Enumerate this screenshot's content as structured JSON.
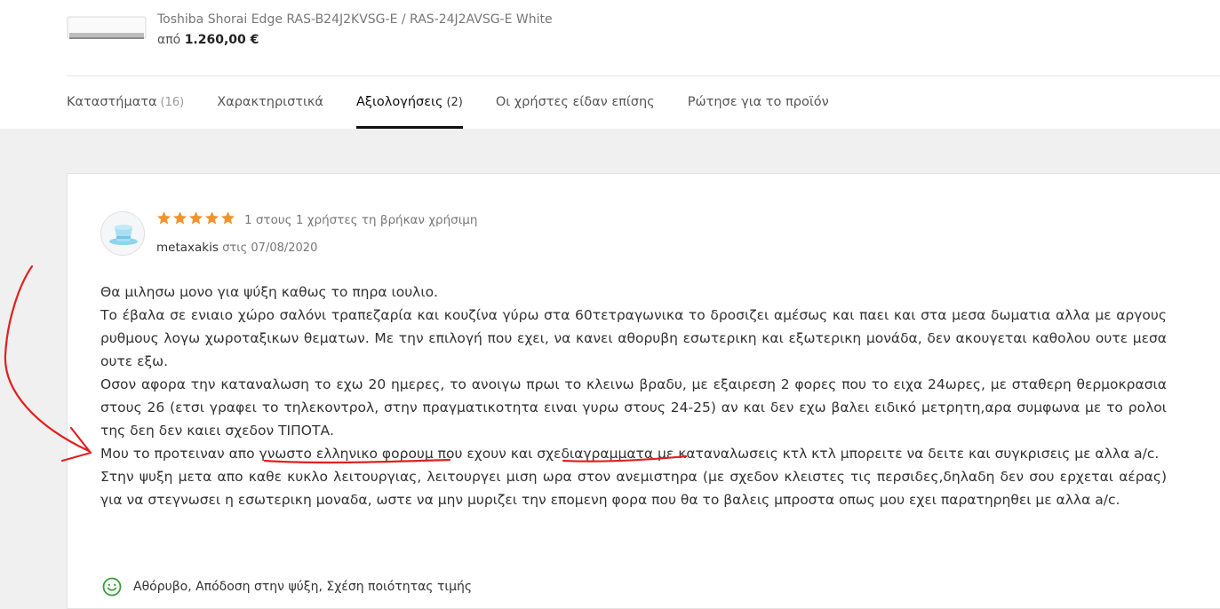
{
  "product": {
    "title": "Toshiba Shorai Edge RAS-B24J2KVSG-E / RAS-24J2AVSG-E White",
    "price_prefix": "από",
    "price": "1.260,00 €"
  },
  "tabs": [
    {
      "label": "Καταστήματα",
      "count": "(16)",
      "active": false
    },
    {
      "label": "Χαρακτηριστικά",
      "count": "",
      "active": false
    },
    {
      "label": "Αξιολογήσεις",
      "count": "(2)",
      "active": true
    },
    {
      "label": "Οι χρήστες είδαν επίσης",
      "count": "",
      "active": false
    },
    {
      "label": "Ρώτησε για το προϊόν",
      "count": "",
      "active": false
    }
  ],
  "review": {
    "rating": 5,
    "rating_max": 5,
    "star_color": "#f0932b",
    "helpful": "1 στους 1 χρήστες τη βρήκαν χρήσιμη",
    "author": "metaxakis",
    "date": "στις 07/08/2020",
    "paragraphs": [
      "Θα μιλησω μονο για ψύξη καθως το πηρα ιουλιο.",
      "Το έβαλα σε ενιαιο χώρο σαλόνι τραπεζαρία και κουζίνα γύρω στα 60τετραγωνικα το δροσιζει αμέσως και παει και στα μεσα δωματια αλλα με αργους ρυθμους λογω χωροταξικων θεματων. Με την επιλογή που εχει, να κανει αθορυβη εσωτερικη και εξωτερικη μονάδα, δεν ακουγεται καθολου ουτε μεσα ουτε εξω.",
      "Οσον αφορα την καταναλωση το εχω 20 ημερες, το ανοιγω πρωι το κλεινω βραδυ, με εξαιρεση 2 φορες που το ειχα 24ωρες, με σταθερη θερμοκρασια στους 26 (ετσι γραφει το τηλεκοντρολ, στην πραγματικοτητα ειναι γυρω στους 24-25) αν και δεν εχω βαλει ειδικό μετρητη,αρα συμφωνα με το ρολοι της δεη δεν καιει σχεδον ΤΙΠΟΤΑ.",
      "Μου το προτειναν απο γνωστο ελληνικο φορουμ που εχουν και σχεδιαγραμματα με καταναλωσεις κτλ κτλ μπορειτε να δειτε και συγκρισεις με αλλα a/c.",
      "Στην ψυξη μετα απο καθε κυκλο λειτουργιας, λειτουργει μιση ωρα στον ανεμιστηρα (με σχεδον κλειστες τις περσιδες,δηλαδη δεν σου ερχεται αέρας) για να στεγνωσει η εσωτερικη μοναδα, ωστε να μην μυριζει την επομενη φορα που θα το βαλεις μπροστα οπως μου εχει παρατηρηθει με αλλα a/c."
    ],
    "pros": "Αθόρυβο, Απόδοση στην ψύξη, Σχέση ποιότητας τιμής",
    "pros_icon": "smile-icon",
    "pros_color": "#3a9d3a"
  },
  "annotation_color": "#e02020"
}
